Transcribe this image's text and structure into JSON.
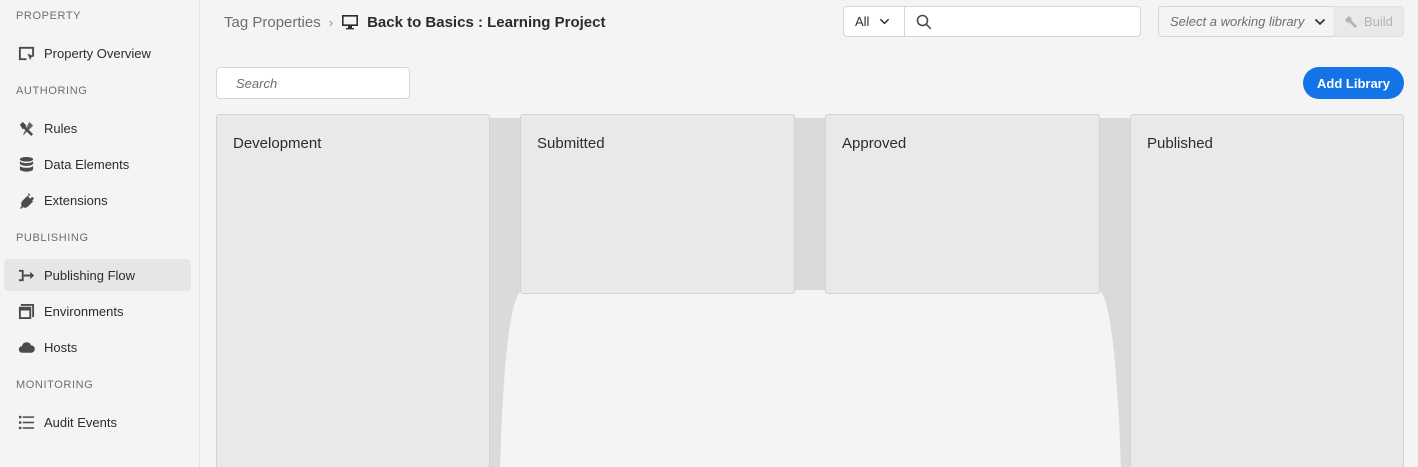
{
  "sidebar": {
    "sections": {
      "property": "PROPERTY",
      "authoring": "AUTHORING",
      "publishing": "PUBLISHING",
      "monitoring": "MONITORING"
    },
    "items": {
      "property_overview": "Property Overview",
      "rules": "Rules",
      "data_elements": "Data Elements",
      "extensions": "Extensions",
      "publishing_flow": "Publishing Flow",
      "environments": "Environments",
      "hosts": "Hosts",
      "audit_events": "Audit Events"
    },
    "active_item": "Publishing Flow"
  },
  "header": {
    "breadcrumb_root": "Tag Properties",
    "breadcrumb_separator": "›",
    "property_name": "Back to Basics : Learning Project",
    "property_icon": "monitor-icon",
    "filter_value": "All",
    "search_value": "",
    "library_select_placeholder": "Select a working library",
    "build_label": "Build"
  },
  "main": {
    "search_placeholder": "Search",
    "add_library_label": "Add Library",
    "columns": {
      "development": "Development",
      "submitted": "Submitted",
      "approved": "Approved",
      "published": "Published"
    }
  },
  "colors": {
    "accent": "#1473e6",
    "background": "#f4f4f4",
    "column": "#e9e9e9"
  }
}
